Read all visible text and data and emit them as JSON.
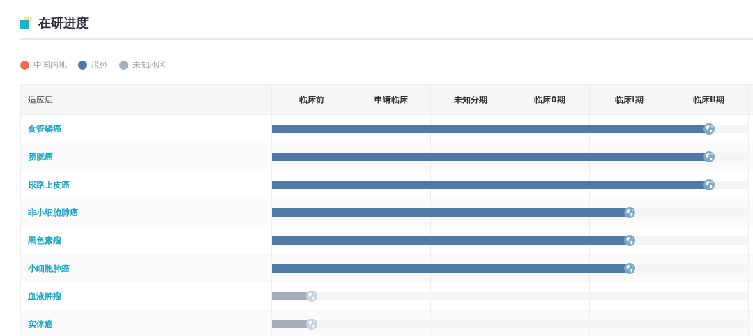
{
  "title": "在研进度",
  "legend": [
    {
      "label": "中国内地",
      "color": "#ef6c57"
    },
    {
      "label": "境外",
      "color": "#507aa6"
    },
    {
      "label": "未知地区",
      "color": "#a6adbb"
    }
  ],
  "table": {
    "columns": [
      "适应症",
      "临床前",
      "申请临床",
      "未知分期",
      "临床0期",
      "临床I期",
      "临床II期"
    ],
    "rows": [
      {
        "name": "食管鳞癌",
        "level": 0.917,
        "color": "#507aa6"
      },
      {
        "name": "膀胱癌",
        "level": 0.917,
        "color": "#507aa6"
      },
      {
        "name": "尿路上皮癌",
        "level": 0.917,
        "color": "#507aa6"
      },
      {
        "name": "非小细胞肺癌",
        "level": 0.75,
        "color": "#507aa6"
      },
      {
        "name": "黑色素瘤",
        "level": 0.75,
        "color": "#507aa6"
      },
      {
        "name": "小细胞肺癌",
        "level": 0.75,
        "color": "#507aa6"
      },
      {
        "name": "血液肿瘤",
        "level": 0.083,
        "color": "#a6adbb"
      },
      {
        "name": "实体瘤",
        "level": 0.083,
        "color": "#a6adbb"
      }
    ]
  }
}
